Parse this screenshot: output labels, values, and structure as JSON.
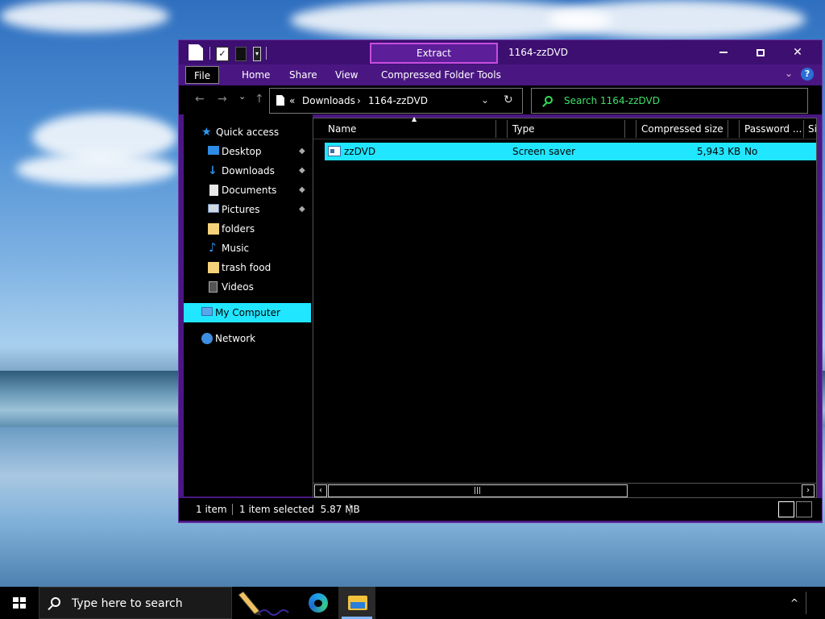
{
  "window": {
    "title": "1164-zzDVD",
    "contextual_tab": "Extract",
    "controls": {
      "minimize": "",
      "maximize": "",
      "close": "✕"
    }
  },
  "quick_access_toolbar": {
    "check_glyph": "✓",
    "dropdown_glyph": "▾"
  },
  "ribbon": {
    "tabs": [
      "File",
      "Home",
      "Share",
      "View",
      "Compressed Folder Tools"
    ],
    "chevron": "⌄",
    "help": "?"
  },
  "navbar": {
    "back": "←",
    "forward": "→",
    "recent": "⌄",
    "up": "↑",
    "address": {
      "overflow": "«",
      "segments": [
        "Downloads",
        "1164-zzDVD"
      ],
      "separator": "›",
      "dropdown": "⌄",
      "refresh": "↻"
    },
    "search": {
      "placeholder": "Search 1164-zzDVD"
    }
  },
  "sidebar": {
    "quick_access": "Quick access",
    "items": [
      {
        "label": "Desktop",
        "icon": "desktop-icon",
        "pinned": true
      },
      {
        "label": "Downloads",
        "icon": "download-arrow-icon",
        "pinned": true
      },
      {
        "label": "Documents",
        "icon": "document-icon",
        "pinned": true
      },
      {
        "label": "Pictures",
        "icon": "picture-icon",
        "pinned": true
      },
      {
        "label": "folders",
        "icon": "folder-icon",
        "pinned": false
      },
      {
        "label": "Music",
        "icon": "music-note-icon",
        "pinned": false
      },
      {
        "label": "trash food",
        "icon": "folder-icon",
        "pinned": false
      },
      {
        "label": "Videos",
        "icon": "film-icon",
        "pinned": false
      }
    ],
    "my_computer": "My Computer",
    "network": "Network",
    "pin_glyph": "📌"
  },
  "file_list": {
    "columns": [
      "Name",
      "Type",
      "Compressed size",
      "Password ...",
      "Si"
    ],
    "rows": [
      {
        "name": "zzDVD",
        "type": "Screen saver",
        "compressed_size": "5,943 KB",
        "password": "No"
      }
    ],
    "sort_caret": "▲",
    "scroll_left": "‹",
    "scroll_right": "›",
    "scroll_grip": "|||"
  },
  "status_bar": {
    "item_count": "1 item",
    "selection": "1 item selected  5.87 MB"
  },
  "taskbar": {
    "search_placeholder": "Type here to search",
    "tray_chevron": "^"
  },
  "colors": {
    "window_frame": "#4a1782",
    "selection": "#20e6ff",
    "search_text": "#3fe06a",
    "extract_border": "#c74de0"
  }
}
